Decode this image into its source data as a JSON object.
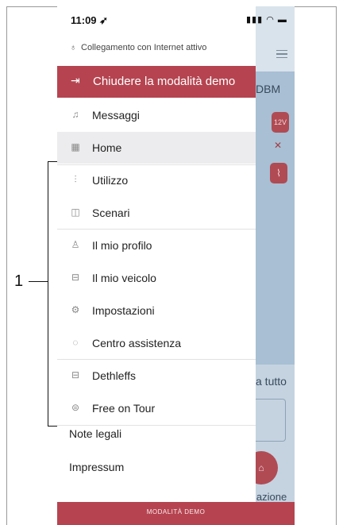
{
  "callout": {
    "number": "1"
  },
  "status_bar": {
    "time": "11:09 ➶",
    "icons": "▮▮▮ ◠ ▬"
  },
  "connection": {
    "icon": "link-icon",
    "text": "Collegamento con Internet attivo"
  },
  "demo_exit": {
    "label": "Chiudere la modalità demo",
    "icon": "exit-icon"
  },
  "menu": [
    {
      "label": "Messaggi",
      "icon": "bell-icon",
      "glyph": "♫"
    },
    {
      "label": "Home",
      "icon": "grid-icon",
      "glyph": "▦",
      "selected": true
    },
    {
      "label": "Utilizzo",
      "icon": "sliders-icon",
      "glyph": "⫶"
    },
    {
      "label": "Scenari",
      "icon": "scenes-icon",
      "glyph": "◫"
    },
    {
      "label": "Il mio profilo",
      "icon": "user-icon",
      "glyph": "♙"
    },
    {
      "label": "Il mio veicolo",
      "icon": "vehicle-icon",
      "glyph": "⊟"
    },
    {
      "label": "Impostazioni",
      "icon": "gear-icon",
      "glyph": "⚙"
    },
    {
      "label": "Centro assistenza",
      "icon": "headset-icon",
      "glyph": "◌"
    },
    {
      "label": "Dethleffs",
      "icon": "caravan-icon",
      "glyph": "⊟"
    },
    {
      "label": "Free on Tour",
      "icon": "globe-icon",
      "glyph": "⊜"
    }
  ],
  "legal": {
    "note": "Note legali",
    "impressum": "Impressum"
  },
  "demo_bar": {
    "label": "MODALITÀ DEMO"
  },
  "background": {
    "partial_title": "DBM",
    "badge_12v": "12V",
    "partial_tutto": "a tutto",
    "partial_lazione": "lazione"
  },
  "colors": {
    "accent": "#b54450",
    "selected_bg": "#ececee",
    "overlay": "#a8bfd4"
  }
}
